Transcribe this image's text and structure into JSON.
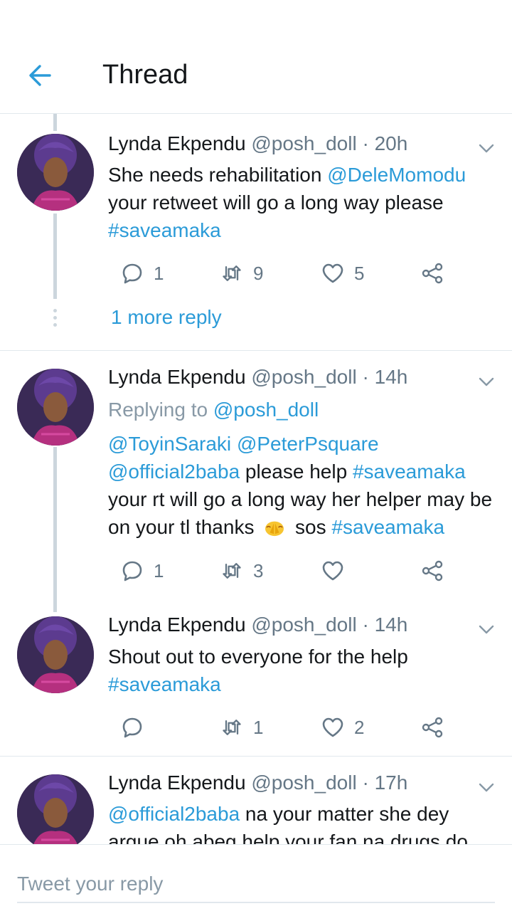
{
  "header": {
    "title": "Thread"
  },
  "tweets": [
    {
      "name": "Lynda Ekpendu",
      "handle": "@posh_doll",
      "dot": "·",
      "time": "20h",
      "body_parts": [
        {
          "t": "She needs rehabilitation "
        },
        {
          "t": "@DeleMomodu",
          "link": true
        },
        {
          "t": " your retweet will go a long way please "
        },
        {
          "t": "#saveamaka",
          "link": true
        }
      ],
      "reply_count": "1",
      "retweet_count": "9",
      "like_count": "5"
    },
    {
      "name": "Lynda Ekpendu",
      "handle": "@posh_doll",
      "dot": "·",
      "time": "14h",
      "replying_label": "Replying to ",
      "replying_handle": "@posh_doll",
      "body_parts": [
        {
          "t": "@ToyinSaraki",
          "link": true
        },
        {
          "t": " "
        },
        {
          "t": "@PeterPsquare",
          "link": true
        },
        {
          "t": " "
        },
        {
          "t": "@official2baba",
          "link": true
        },
        {
          "t": " please help "
        },
        {
          "t": "#saveamaka",
          "link": true
        },
        {
          "t": " your rt will go a long way her helper may be on your tl thanks "
        },
        {
          "emoji": "pray"
        },
        {
          "t": " sos  "
        },
        {
          "t": "#saveamaka",
          "link": true
        }
      ],
      "reply_count": "1",
      "retweet_count": "3",
      "like_count": ""
    },
    {
      "name": "Lynda Ekpendu",
      "handle": "@posh_doll",
      "dot": "·",
      "time": "14h",
      "body_parts": [
        {
          "t": "Shout out to everyone for the help "
        },
        {
          "t": "#saveamaka",
          "link": true
        }
      ],
      "reply_count": "",
      "retweet_count": "1",
      "like_count": "2"
    },
    {
      "name": "Lynda Ekpendu",
      "handle": "@posh_doll",
      "dot": "·",
      "time": "17h",
      "body_parts": [
        {
          "t": "@official2baba",
          "link": true
        },
        {
          "t": " na your matter she dey argue oh abeg help your fan na drugs do"
        }
      ]
    }
  ],
  "more_replies": "1 more reply",
  "reply_bar": {
    "placeholder": "Tweet your reply"
  },
  "colors": {
    "accent": "#2b9bd8",
    "muted": "#657786",
    "divider": "#e1e8ed"
  },
  "icons": [
    "back-arrow-icon",
    "chevron-down-icon",
    "reply-icon",
    "retweet-icon",
    "like-icon",
    "share-icon",
    "praying-hands-emoji"
  ]
}
